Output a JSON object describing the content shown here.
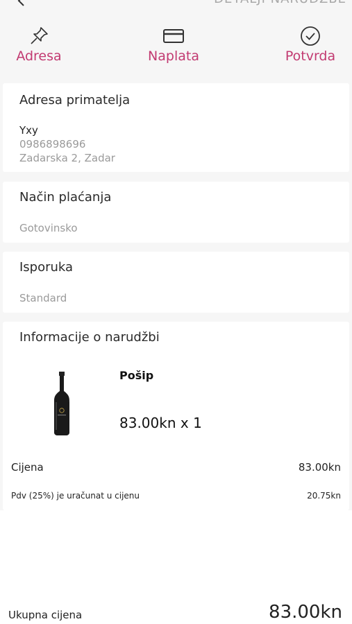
{
  "header": {
    "title": "DETALJI NARUDŽBE"
  },
  "steps": [
    {
      "label": "Adresa",
      "icon": "pin-icon"
    },
    {
      "label": "Naplata",
      "icon": "credit-card-icon"
    },
    {
      "label": "Potvrda",
      "icon": "check-circle-icon"
    }
  ],
  "address": {
    "title": "Adresa primatelja",
    "name": "Yxy",
    "phone": "0986898696",
    "street": "Zadarska 2, Zadar"
  },
  "payment": {
    "title": "Način plaćanja",
    "method": "Gotovinsko"
  },
  "delivery": {
    "title": "Isporuka",
    "method": "Standard"
  },
  "order": {
    "title": "Informacije o narudžbi",
    "product_name": "Pošip",
    "product_price_qty": "83.00kn x 1",
    "price_label": "Cijena",
    "price_value": "83.00kn",
    "vat_label": "Pdv (25%) je uračunat u cijenu",
    "vat_value": "20.75kn"
  },
  "total": {
    "label": "Ukupna cijena",
    "value": "83.00kn"
  },
  "colors": {
    "accent": "#c23a71",
    "muted_text": "#9a9a9a",
    "background": "#f6f6f6"
  }
}
